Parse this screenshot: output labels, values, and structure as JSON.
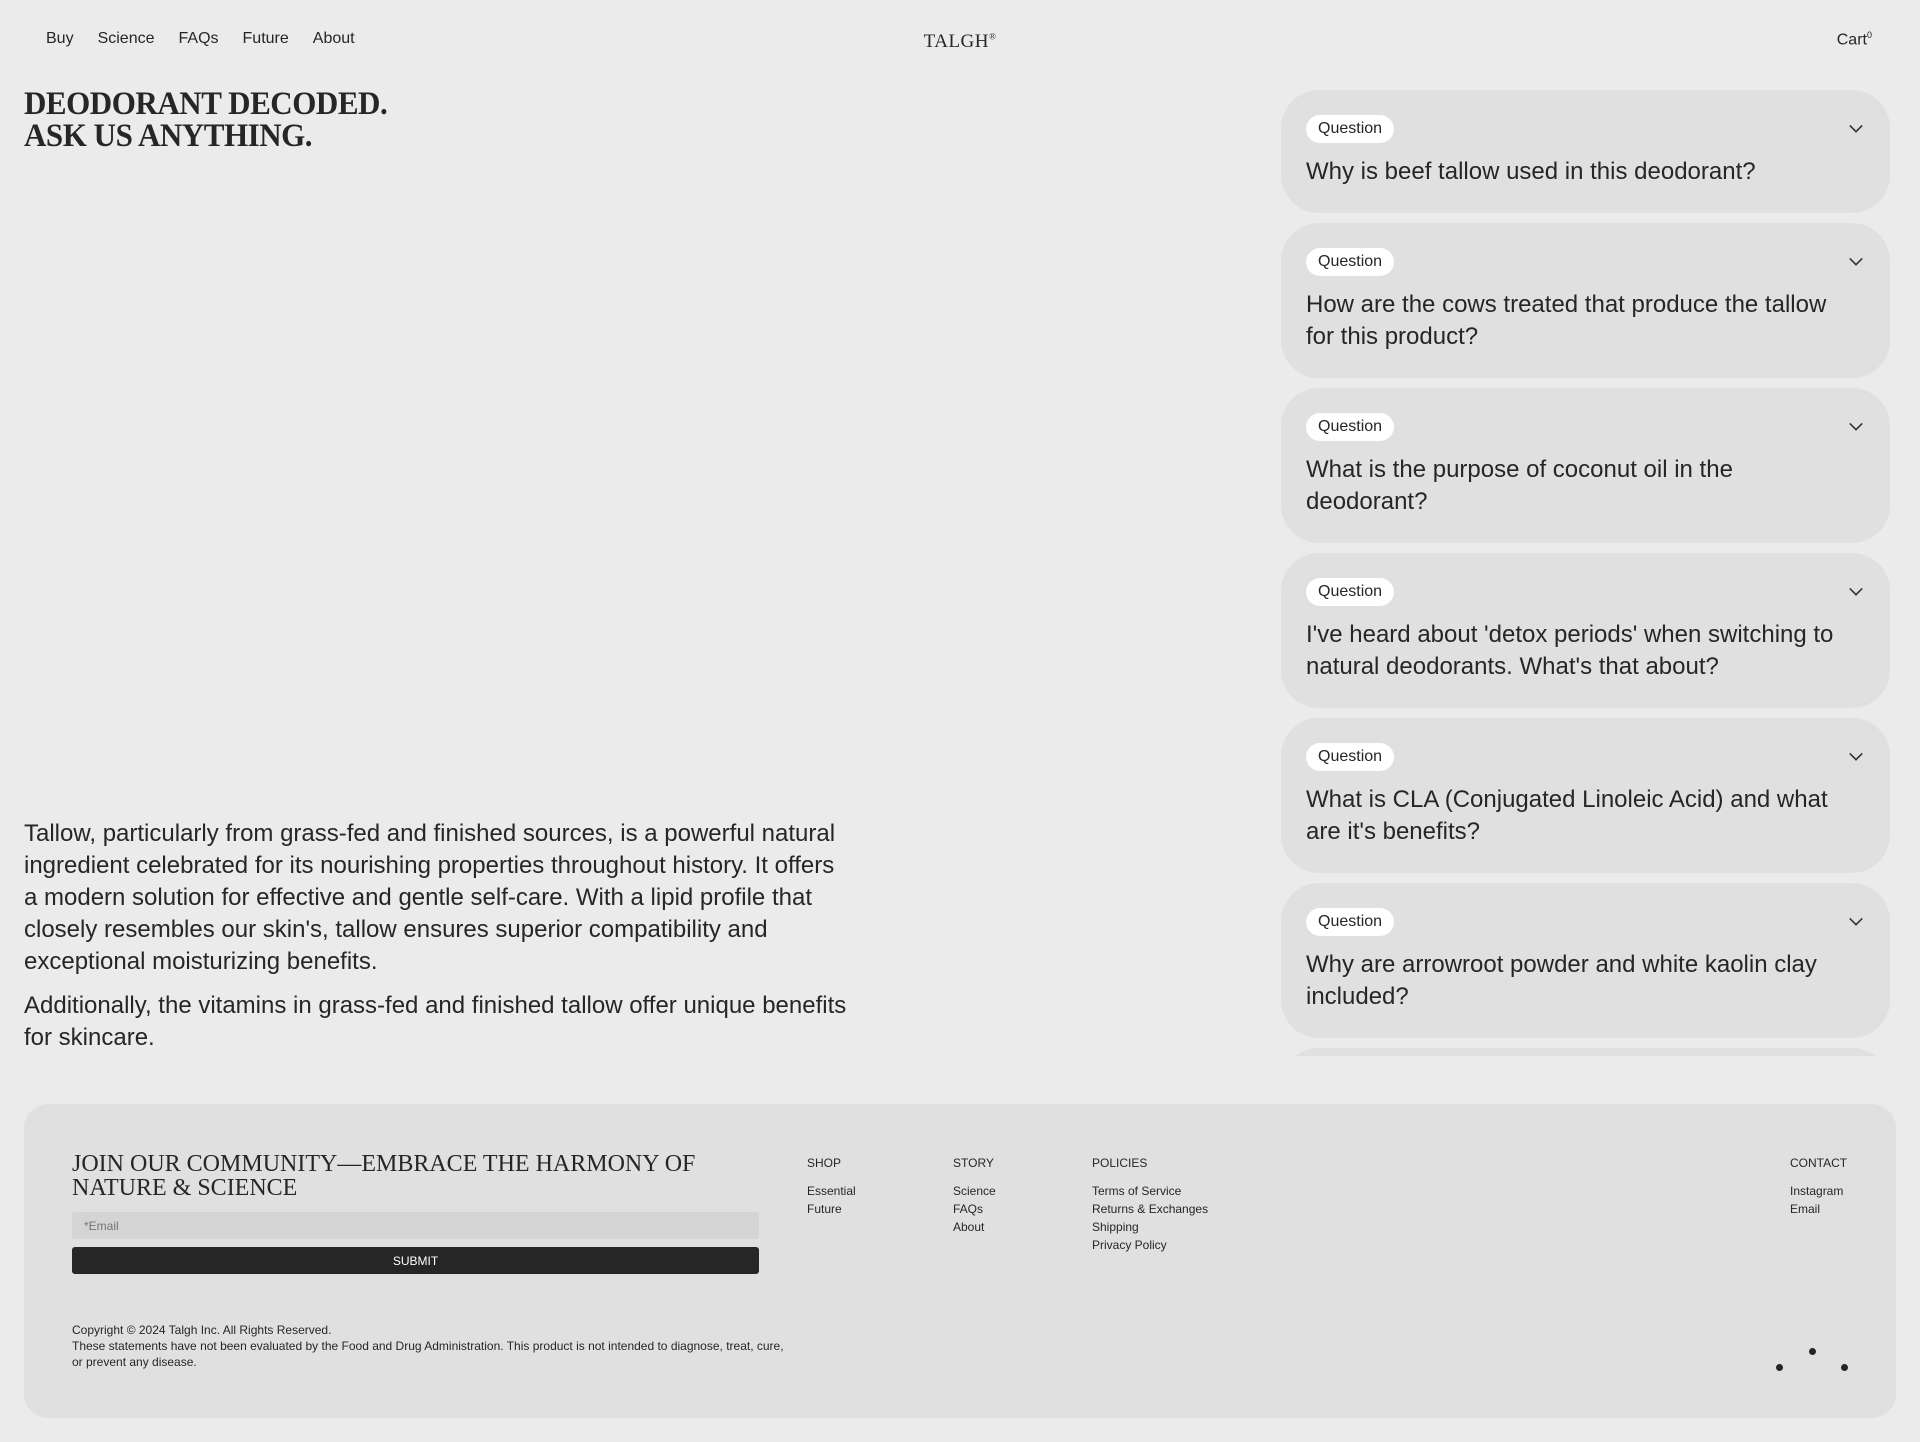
{
  "nav": {
    "items": [
      "Buy",
      "Science",
      "FAQs",
      "Future",
      "About"
    ],
    "logo": "TALGH",
    "logo_mark": "®",
    "cart": "Cart",
    "cart_count": "0"
  },
  "hero": {
    "title_line1": "DEODORANT DECODED.",
    "title_line2": "ASK US ANYTHING."
  },
  "intro": {
    "p1": "Tallow, particularly from grass-fed and finished sources, is a powerful natural ingredient celebrated for its nourishing properties throughout history. It offers a modern solution for effective and gentle self-care. With a lipid profile that closely resembles our skin's, tallow ensures superior compatibility and exceptional moisturizing benefits.",
    "p2": "Additionally, the vitamins in grass-fed and finished tallow offer unique benefits for skincare."
  },
  "faq": {
    "tag": "Question",
    "items": [
      "Why is beef tallow used in this deodorant?",
      "How are the cows treated that produce the tallow for this product?",
      "What is the purpose of coconut oil in the deodorant?",
      "I've heard about 'detox periods' when switching to natural deodorants. What's that about?",
      "What is CLA (Conjugated Linoleic Acid) and what are it's benefits?",
      "Why are arrowroot powder and white kaolin clay included?"
    ]
  },
  "footer": {
    "heading": "JOIN OUR COMMUNITY—EMBRACE THE HARMONY OF NATURE & SCIENCE",
    "email_placeholder": "*Email",
    "submit": "SUBMIT",
    "shop": {
      "title": "SHOP",
      "items": [
        "Essential",
        "Future"
      ]
    },
    "story": {
      "title": "STORY",
      "items": [
        "Science",
        "FAQs",
        "About"
      ]
    },
    "policies": {
      "title": "POLICIES",
      "items": [
        "Terms of Service",
        "Returns & Exchanges",
        "Shipping",
        "Privacy Policy"
      ]
    },
    "contact": {
      "title": "CONTACT",
      "items": [
        "Instagram",
        "Email"
      ]
    },
    "copyright": "Copyright © 2024 Talgh Inc. All Rights Reserved.",
    "disclaimer": "These statements have not been evaluated by the Food and Drug Administration. This product is not intended to diagnose, treat, cure, or prevent any disease."
  }
}
